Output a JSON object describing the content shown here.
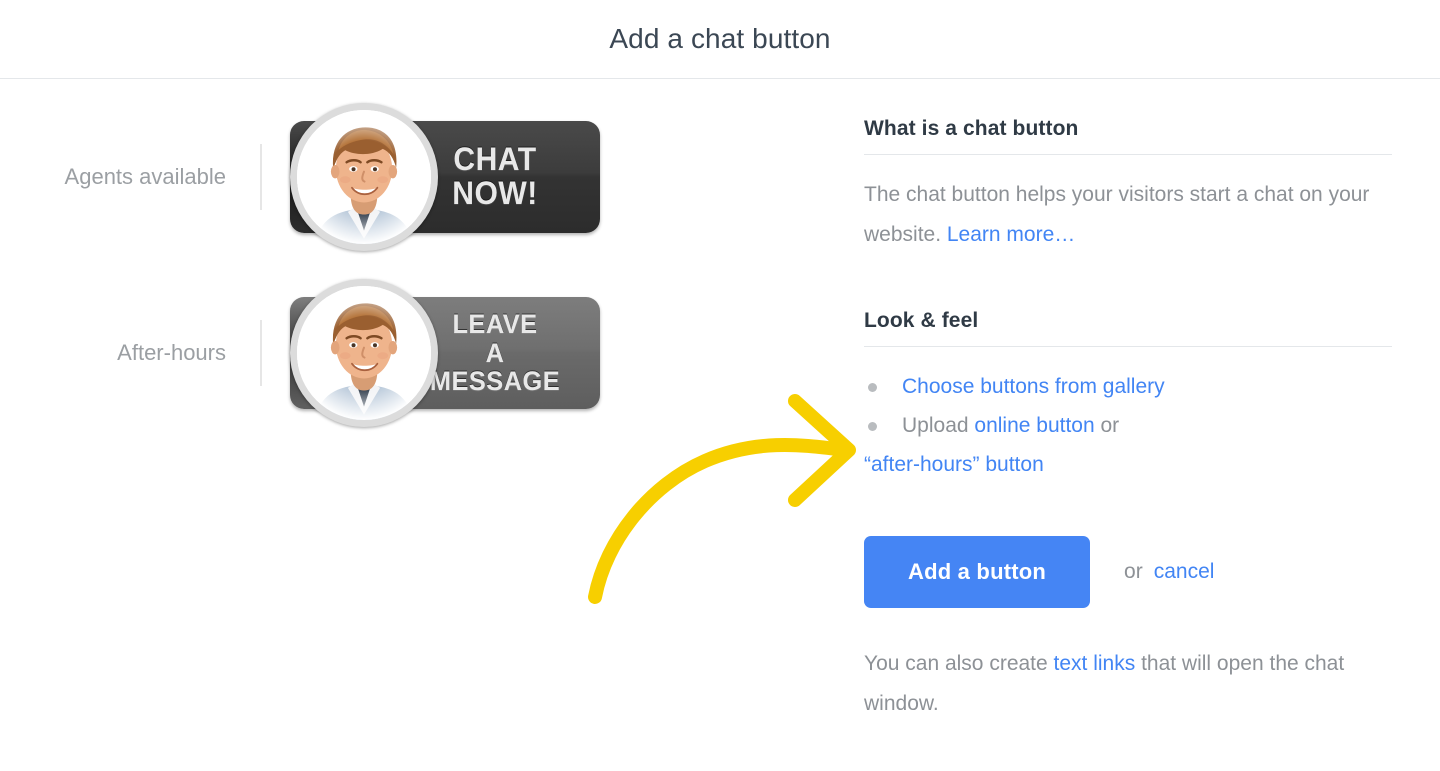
{
  "header": {
    "title": "Add a chat button"
  },
  "preview": {
    "rows": [
      {
        "label": "Agents available",
        "state": "online",
        "button_text_lines": [
          "CHAT NOW!"
        ],
        "button_color": "#333333",
        "avatar": "agent-avatar"
      },
      {
        "label": "After-hours",
        "state": "offline",
        "button_text_lines": [
          "LEAVE",
          "A MESSAGE"
        ],
        "button_color": "#6a6a6a",
        "avatar": "agent-avatar"
      }
    ]
  },
  "info": {
    "heading": "What is a chat button",
    "body_part1": "The chat button helps your visitors start a chat on your website. ",
    "learn_more_link": "Learn more…"
  },
  "look_and_feel": {
    "heading": "Look & feel",
    "bullet1_link": "Choose buttons from gallery",
    "bullet2_prefix": "Upload ",
    "bullet2_link1": "online button",
    "bullet2_middle": " or",
    "bullet2_link2": "“after-hours” button"
  },
  "actions": {
    "primary_label": "Add a button",
    "or_label": "or",
    "cancel_label": "cancel"
  },
  "footnote": {
    "part1": "You can also create ",
    "link": "text links",
    "part2": " that will open the chat window."
  },
  "annotation": {
    "type": "curved-arrow",
    "color": "#f7cf00",
    "points_to": "Upload online button"
  },
  "colors": {
    "accent_blue": "#4285f4",
    "title_text": "#3b4754",
    "body_text": "#8d9196",
    "divider": "#e4e7ea",
    "arrow_yellow": "#f7cf00"
  }
}
